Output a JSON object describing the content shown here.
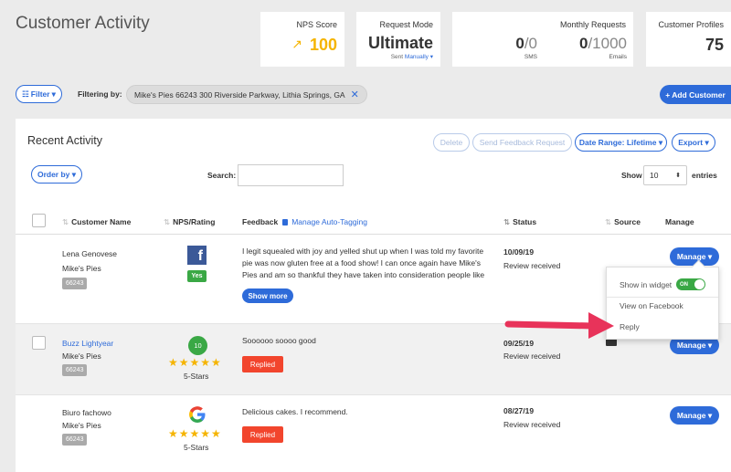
{
  "page": {
    "title": "Customer Activity"
  },
  "stats": {
    "nps": {
      "label": "NPS Score",
      "value": "100",
      "trend_icon": "trend-up-icon"
    },
    "request_mode": {
      "label": "Request Mode",
      "value": "Ultimate",
      "sent_text": "Sent",
      "sent_link": "Manually"
    },
    "monthly": {
      "label": "Monthly Requests",
      "sms_used": "0",
      "sms_total": "/0",
      "sms_caption": "SMS",
      "email_used": "0",
      "email_total": "/1000",
      "email_caption": "Emails"
    },
    "profiles": {
      "label": "Customer Profiles",
      "value": "75"
    }
  },
  "filter_bar": {
    "filter_button": "Filter",
    "filtering_label": "Filtering by:",
    "chip": "Mike's Pies 66243 300 Riverside Parkway, Lithia Springs, GA",
    "add_customer": "+ Add Customer"
  },
  "panel": {
    "title": "Recent Activity",
    "actions": {
      "delete": "Delete",
      "send_feedback": "Send Feedback Request",
      "date_range": "Date Range: Lifetime",
      "export": "Export"
    },
    "order_by": "Order by",
    "search_label": "Search:",
    "search_value": "",
    "show_label": "Show",
    "show_value": "10",
    "entries_label": "entries"
  },
  "table": {
    "columns": {
      "customer": "Customer Name",
      "nps": "NPS/Rating",
      "feedback": "Feedback",
      "auto_tagging": "Manage Auto-Tagging",
      "status": "Status",
      "source": "Source",
      "manage": "Manage"
    },
    "rows": [
      {
        "name": "Lena Genovese",
        "business": "Mike's Pies",
        "location": "66243",
        "rating_badge": "Yes",
        "feedback": "I legit squealed with joy and yelled shut up when I was told my favorite pie was now gluten free at a food show! I can once again have Mike's Pies and am so thankful they have taken into consideration people like",
        "show_more": "Show more",
        "date": "10/09/19",
        "status": "Review received",
        "manage": "Manage"
      },
      {
        "name": "Buzz Lightyear",
        "business": "Mike's Pies",
        "location": "66243",
        "score": "10",
        "stars": "★★★★★",
        "stars_label": "5-Stars",
        "feedback": "Soooooo soooo good",
        "replied": "Replied",
        "date": "09/25/19",
        "status": "Review received",
        "manage": "Manage"
      },
      {
        "name": "Biuro fachowo",
        "business": "Mike's Pies",
        "location": "66243",
        "stars": "★★★★★",
        "stars_label": "5-Stars",
        "feedback": "Delicious cakes. I recommend.",
        "replied": "Replied",
        "date": "08/27/19",
        "status": "Review received",
        "manage": "Manage"
      }
    ]
  },
  "manage_menu": {
    "show_in_widget": "Show in widget",
    "toggle_label": "ON",
    "view_on_facebook": "View on Facebook",
    "reply": "Reply"
  },
  "colors": {
    "accent": "#2e6bd9",
    "nps": "#f5b400",
    "success": "#3aa845",
    "replied": "#f2452d",
    "arrow": "#e8335a"
  }
}
